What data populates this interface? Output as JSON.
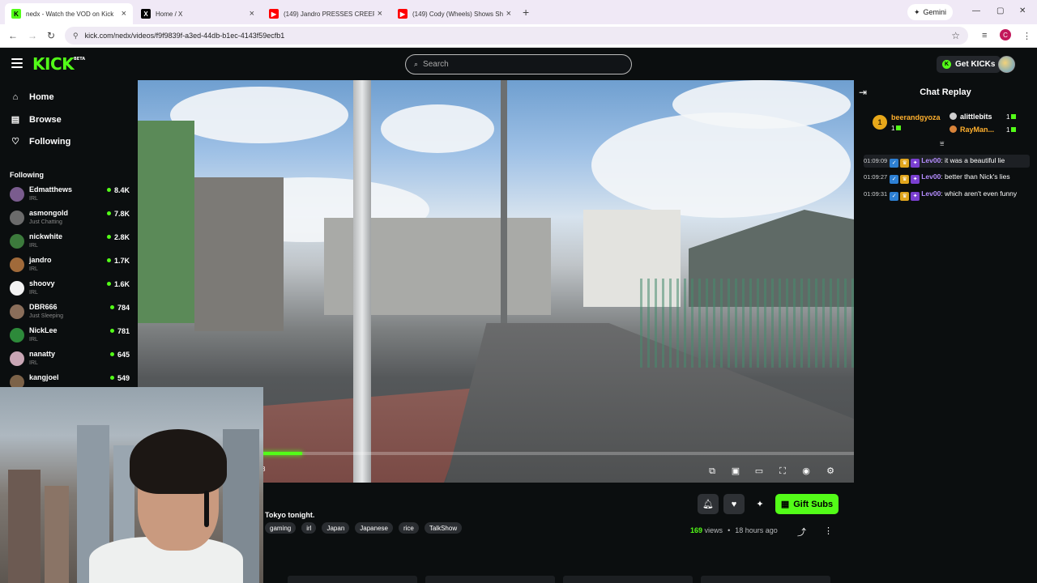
{
  "browser": {
    "tabs": [
      {
        "title": "nedx - Watch the VOD on Kick",
        "favicon": "kick-logo",
        "color": "#53fc18"
      },
      {
        "title": "Home / X",
        "favicon": "x-logo",
        "color": "#000000"
      },
      {
        "title": "(149) Jandro PRESSES CREEPY S",
        "favicon": "youtube-logo",
        "color": "#ff0000"
      },
      {
        "title": "(149) Cody (Wheels) Shows Sha",
        "favicon": "youtube-logo",
        "color": "#ff0000"
      }
    ],
    "new_tab": "+",
    "gemini_label": "Gemini",
    "url": "kick.com/nedx/videos/f9f9839f-a3ed-44db-b1ec-4143f59ecfb1",
    "profile_initial": "C"
  },
  "header": {
    "logo": "KICK",
    "logo_tag": "BETA",
    "search_placeholder": "Search",
    "get_kicks_label": "Get KICKs"
  },
  "sidebar": {
    "nav": [
      {
        "label": "Home",
        "icon": "home-icon"
      },
      {
        "label": "Browse",
        "icon": "browse-icon"
      },
      {
        "label": "Following",
        "icon": "heart-icon"
      }
    ],
    "following_heading": "Following",
    "channels": [
      {
        "name": "Edmatthews",
        "category": "IRL",
        "viewers": "8.4K",
        "avatar_color": "#7a5c8e"
      },
      {
        "name": "asmongold",
        "category": "Just Chatting",
        "viewers": "7.8K",
        "avatar_color": "#6b6b6b"
      },
      {
        "name": "nickwhite",
        "category": "IRL",
        "viewers": "2.8K",
        "avatar_color": "#3c7a3c"
      },
      {
        "name": "jandro",
        "category": "IRL",
        "viewers": "1.7K",
        "avatar_color": "#a06a3a"
      },
      {
        "name": "shoovy",
        "category": "IRL",
        "viewers": "1.6K",
        "avatar_color": "#f2f2f2"
      },
      {
        "name": "DBR666",
        "category": "Just Sleeping",
        "viewers": "784",
        "avatar_color": "#8a6e5a"
      },
      {
        "name": "NickLee",
        "category": "IRL",
        "viewers": "781",
        "avatar_color": "#2d8a3a"
      },
      {
        "name": "nanatty",
        "category": "IRL",
        "viewers": "645",
        "avatar_color": "#c9a6b5"
      },
      {
        "name": "kangjoel",
        "category": "",
        "viewers": "549",
        "avatar_color": "#7c6248"
      }
    ]
  },
  "player": {
    "progress": 0.23,
    "time_fragment": "3"
  },
  "video_info": {
    "title_fragment": "Tokyo tonight.",
    "tags": [
      "gaming",
      "irl",
      "Japan",
      "Japanese",
      "rice",
      "TalkShow"
    ],
    "gift_subs_label": "Gift Subs",
    "views_count": "169",
    "views_label": "views",
    "separator": "•",
    "age": "18 hours ago"
  },
  "chat": {
    "title": "Chat Replay",
    "leaders": [
      {
        "rank": "1",
        "name": "beerandgyoza",
        "count": "1",
        "color": "#ffb02e"
      },
      {
        "name": "alittlebits",
        "count": "1",
        "color": "#ffffff"
      },
      {
        "name": "RayMan...",
        "count": "1",
        "color": "#ffb02e"
      }
    ],
    "messages": [
      {
        "time": "01:09:09",
        "user": "Lev00",
        "text": "it was a beautiful lie"
      },
      {
        "time": "01:09:27",
        "user": "Lev00",
        "text": "better than Nick's lies"
      },
      {
        "time": "01:09:31",
        "user": "Lev00",
        "text": "which aren't even funny"
      }
    ]
  },
  "colors": {
    "accent": "#53fc18",
    "background": "#0b0e0f",
    "chat_user": "#b58dff"
  }
}
